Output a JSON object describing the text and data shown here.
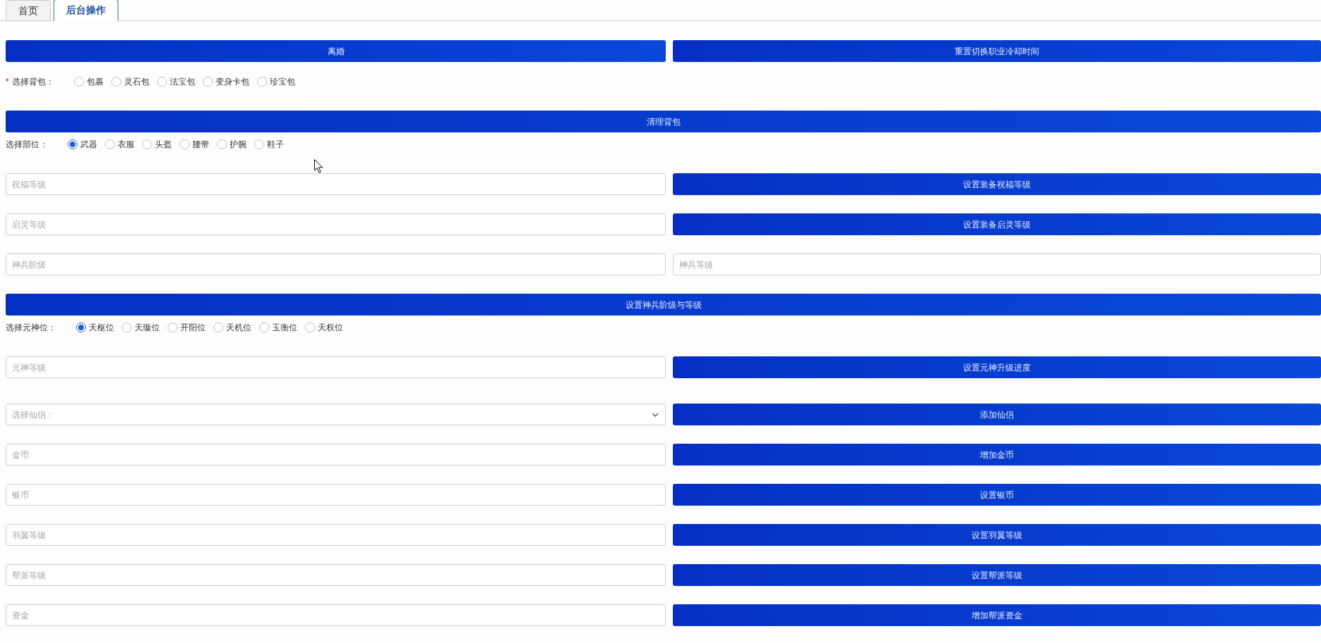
{
  "tabs": [
    {
      "label": "首页",
      "selected": false
    },
    {
      "label": "后台操作",
      "selected": true
    }
  ],
  "rows": [
    {
      "kind": "button_pair",
      "buttons": [
        "离婚",
        "重置切换职业冷却时间"
      ]
    },
    {
      "kind": "radio_group",
      "required_mark": "*",
      "label": "选择背包：",
      "options": [
        {
          "label": "包裹",
          "selected": false
        },
        {
          "label": "灵石包",
          "selected": false
        },
        {
          "label": "法宝包",
          "selected": false
        },
        {
          "label": "变身卡包",
          "selected": false
        },
        {
          "label": "珍宝包",
          "selected": false
        }
      ]
    },
    {
      "kind": "wide_button",
      "button": "清理背包"
    },
    {
      "kind": "radio_group",
      "label": "选择部位：",
      "options": [
        {
          "label": "武器",
          "selected": true
        },
        {
          "label": "衣服",
          "selected": false
        },
        {
          "label": "头盔",
          "selected": false
        },
        {
          "label": "腰带",
          "selected": false
        },
        {
          "label": "护腕",
          "selected": false
        },
        {
          "label": "鞋子",
          "selected": false
        }
      ]
    },
    {
      "kind": "field_button",
      "placeholder": "祝福等级",
      "button": "设置装备祝福等级"
    },
    {
      "kind": "field_button",
      "placeholder": "启灵等级",
      "button": "设置装备启灵等级"
    },
    {
      "kind": "field_pair",
      "placeholders": [
        "神兵阶级",
        "神兵等级"
      ]
    },
    {
      "kind": "wide_button",
      "button": "设置神兵阶级与等级"
    },
    {
      "kind": "radio_group",
      "label": "选择元神位：",
      "options": [
        {
          "label": "天枢位",
          "selected": true
        },
        {
          "label": "天璇位",
          "selected": false
        },
        {
          "label": "开阳位",
          "selected": false
        },
        {
          "label": "天机位",
          "selected": false
        },
        {
          "label": "玉衡位",
          "selected": false
        },
        {
          "label": "天权位",
          "selected": false
        }
      ]
    },
    {
      "kind": "field_button",
      "placeholder": "元神等级",
      "button": "设置元神升级进度"
    },
    {
      "kind": "select_button",
      "placeholder": "选择仙侣：",
      "button": "添加仙侣"
    },
    {
      "kind": "field_button",
      "placeholder": "金币",
      "button": "增加金币"
    },
    {
      "kind": "field_button",
      "placeholder": "银币",
      "button": "设置银币"
    },
    {
      "kind": "field_button",
      "placeholder": "羽翼等级",
      "button": "设置羽翼等级"
    },
    {
      "kind": "field_button",
      "placeholder": "帮派等级",
      "button": "设置帮派等级"
    },
    {
      "kind": "field_button",
      "placeholder": "资金",
      "button": "增加帮派资金"
    }
  ]
}
